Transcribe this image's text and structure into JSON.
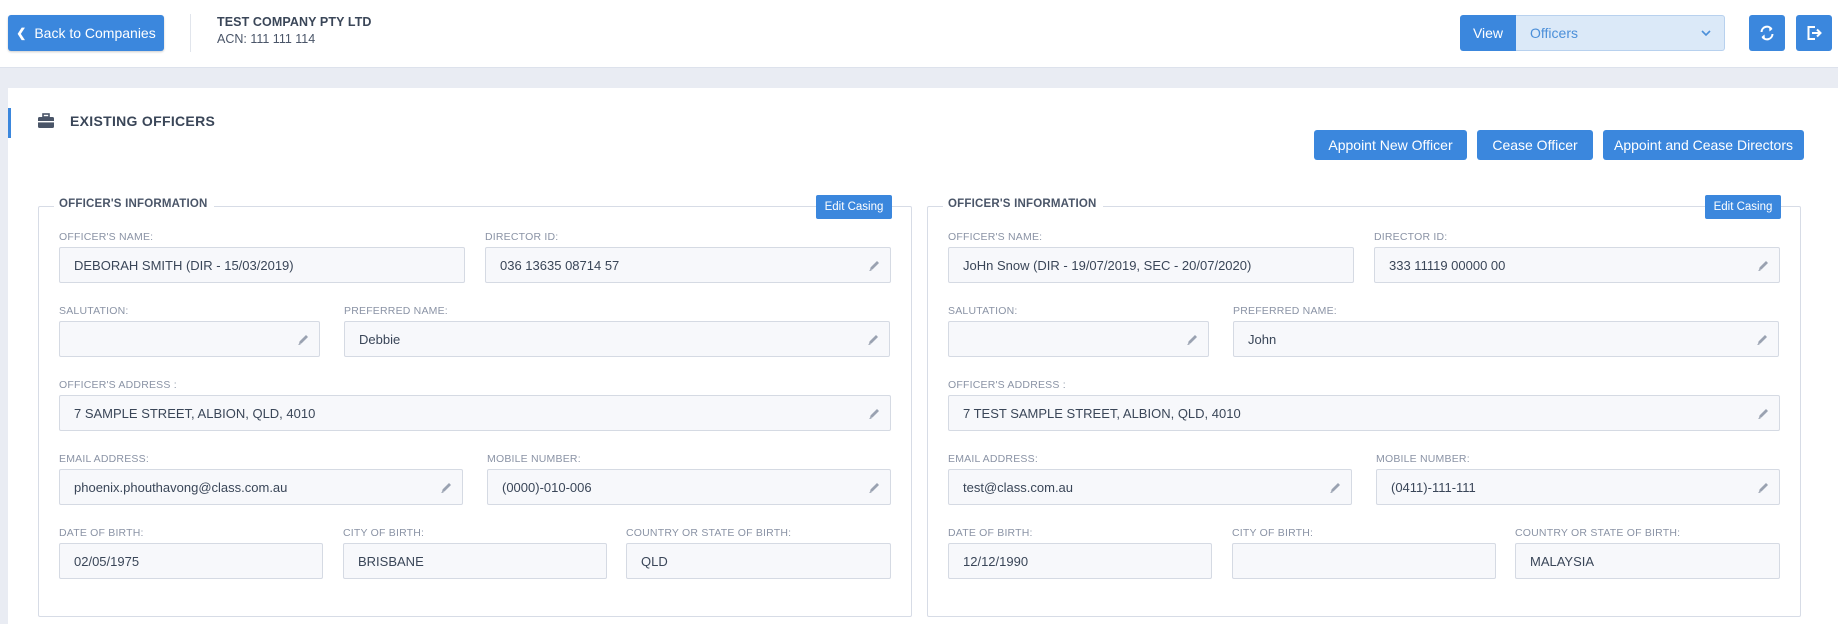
{
  "header": {
    "back_label": "Back to Companies",
    "company_name": "TEST COMPANY PTY LTD",
    "acn": "ACN: 111 111 114",
    "view_label": "View",
    "view_selected": "Officers"
  },
  "section": {
    "title": "EXISTING OFFICERS"
  },
  "actions": {
    "appoint": "Appoint New Officer",
    "cease": "Cease Officer",
    "appoint_cease": "Appoint and Cease Directors"
  },
  "labels": {
    "legend": "OFFICER'S INFORMATION",
    "edit_casing": "Edit Casing",
    "officer_name": "OFFICER'S NAME:",
    "director_id": "DIRECTOR ID:",
    "salutation": "SALUTATION:",
    "preferred_name": "PREFERRED NAME:",
    "address": "OFFICER'S ADDRESS :",
    "email": "EMAIL ADDRESS:",
    "mobile": "MOBILE NUMBER:",
    "dob": "DATE OF BIRTH:",
    "city": "CITY OF BIRTH:",
    "country": "COUNTRY OR STATE OF BIRTH:"
  },
  "officers": [
    {
      "name": "DEBORAH SMITH (DIR - 15/03/2019)",
      "director_id": "036 13635 08714 57",
      "salutation": "",
      "preferred_name": "Debbie",
      "address": "7 SAMPLE STREET, ALBION, QLD, 4010",
      "email": "phoenix.phouthavong@class.com.au",
      "mobile": "(0000)-010-006",
      "dob": "02/05/1975",
      "city": "BRISBANE",
      "country": "QLD"
    },
    {
      "name": "JoHn Snow (DIR - 19/07/2019, SEC - 20/07/2020)",
      "director_id": "333 11119 00000 00",
      "salutation": "",
      "preferred_name": "John",
      "address": "7 TEST SAMPLE STREET, ALBION, QLD, 4010",
      "email": "test@class.com.au",
      "mobile": "(0411)-111-111",
      "dob": "12/12/1990",
      "city": "",
      "country": "MALAYSIA"
    }
  ],
  "icons": {
    "back": "chevron-left-icon",
    "dropdown": "chevron-down-icon",
    "refresh": "refresh-icon",
    "logout": "logout-icon",
    "section": "briefcase-icon",
    "edit": "pencil-icon"
  },
  "colors": {
    "accent": "#3b87dd",
    "select_bg": "#dbe9f8",
    "field_bg": "#f7f8fb"
  }
}
